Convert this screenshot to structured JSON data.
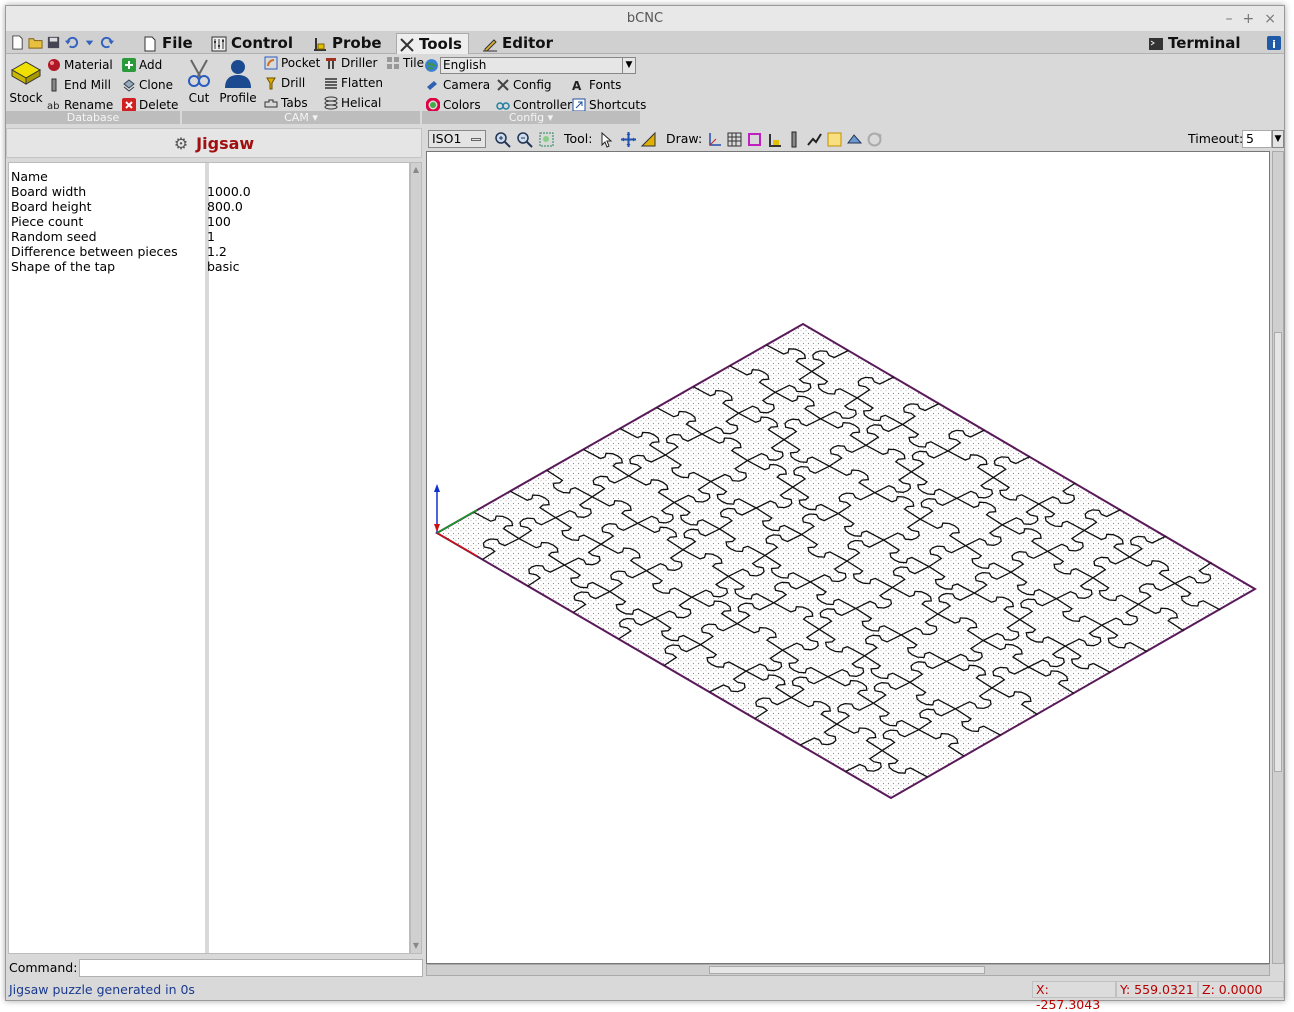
{
  "window": {
    "title": "bCNC"
  },
  "tabs": {
    "file": "File",
    "control": "Control",
    "probe": "Probe",
    "tools": "Tools",
    "editor": "Editor",
    "terminal": "Terminal"
  },
  "ribbon": {
    "database": {
      "title": "Database",
      "stock": "Stock",
      "material": "Material",
      "end_mill": "End Mill",
      "rename": "Rename",
      "add": "Add",
      "clone": "Clone",
      "delete": "Delete"
    },
    "cam": {
      "title": "CAM",
      "cut": "Cut",
      "profile": "Profile",
      "pocket": "Pocket",
      "drill": "Drill",
      "tabs": "Tabs",
      "driller": "Driller",
      "flatten": "Flatten",
      "helical": "Helical",
      "tile": "Tile"
    },
    "config": {
      "title": "Config",
      "language": "English",
      "camera": "Camera",
      "config": "Config",
      "fonts": "Fonts",
      "colors": "Colors",
      "controller": "Controller",
      "shortcuts": "Shortcuts"
    }
  },
  "panel": {
    "title": "Jigsaw",
    "properties": [
      {
        "key": "Name",
        "value": ""
      },
      {
        "key": "Board width",
        "value": "1000.0"
      },
      {
        "key": "Board height",
        "value": "800.0"
      },
      {
        "key": "Piece count",
        "value": "100"
      },
      {
        "key": "Random seed",
        "value": "1"
      },
      {
        "key": "Difference between pieces",
        "value": "1.2"
      },
      {
        "key": "Shape of the tap",
        "value": "basic"
      }
    ]
  },
  "command": {
    "label": "Command:",
    "value": ""
  },
  "canvas_toolbar": {
    "view": "ISO1",
    "tool_label": "Tool:",
    "draw_label": "Draw:",
    "timeout_label": "Timeout:",
    "timeout_value": "5"
  },
  "status": {
    "message": "Jigsaw puzzle generated in 0s",
    "x": "X: -257.3043",
    "y": "Y: 559.0321",
    "z": "Z: 0.0000"
  },
  "colors": {
    "panel_title": "#a01010",
    "status_text": "#1a3a8f",
    "coord_text": "#b80000",
    "board_outline": "#5a1a5a"
  }
}
